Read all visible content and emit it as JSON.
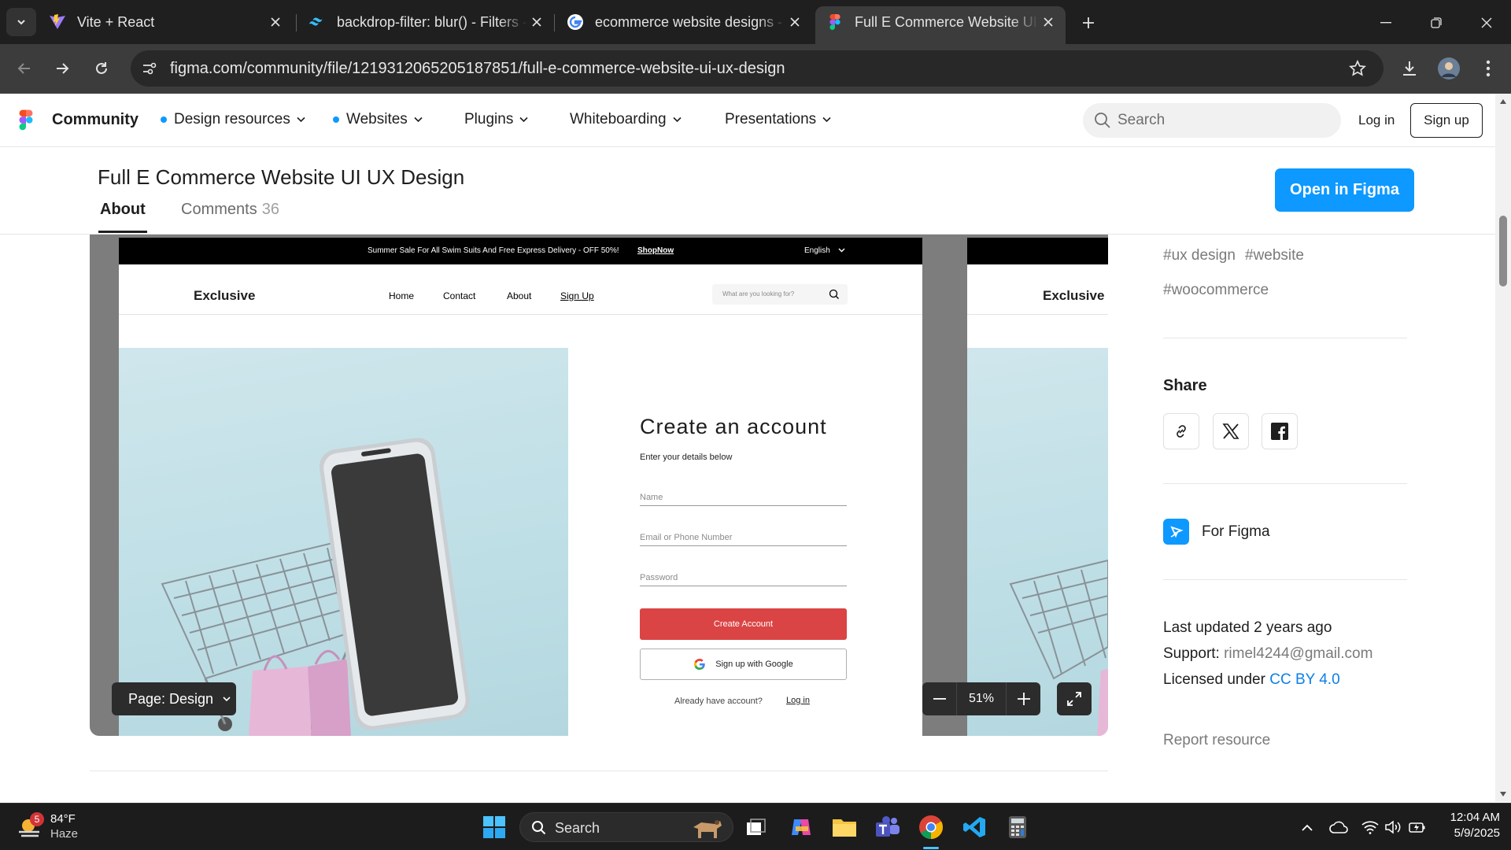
{
  "browser": {
    "tabs": [
      {
        "title": "Vite + React",
        "favicon": "vite-icon"
      },
      {
        "title": "backdrop-filter: blur() - Filters -",
        "favicon": "tailwind-icon"
      },
      {
        "title": "ecommerce website designs - G",
        "favicon": "google-icon"
      },
      {
        "title": "Full E Commerce Website UI UX",
        "favicon": "figma-icon",
        "active": true
      }
    ],
    "url": "figma.com/community/file/1219312065205187851/full-e-commerce-website-ui-ux-design"
  },
  "header": {
    "brand": "Community",
    "nav": [
      {
        "label": "Design resources",
        "dot": true
      },
      {
        "label": "Websites",
        "dot": true
      },
      {
        "label": "Plugins",
        "dot": false
      },
      {
        "label": "Whiteboarding",
        "dot": false
      },
      {
        "label": "Presentations",
        "dot": false
      }
    ],
    "search_placeholder": "Search",
    "login": "Log in",
    "signup": "Sign up"
  },
  "file": {
    "title": "Full E Commerce Website UI UX Design",
    "tab_about": "About",
    "tab_comments": "Comments",
    "comments_count": "36",
    "open_button": "Open in Figma"
  },
  "preview": {
    "promo_text": "Summer Sale For All Swim Suits And Free Express Delivery - OFF 50%!",
    "promo_link": "ShopNow",
    "language": "English",
    "logo": "Exclusive",
    "nav": [
      "Home",
      "Contact",
      "About",
      "Sign Up"
    ],
    "search_placeholder": "What are you looking for?",
    "form_title": "Create an account",
    "form_subtitle": "Enter your details below",
    "fields": [
      "Name",
      "Email or Phone Number",
      "Password"
    ],
    "create_button": "Create Account",
    "google_button": "Sign up with Google",
    "have_account": "Already have account?",
    "login_link": "Log in",
    "page_selector": "Page: Design",
    "zoom": "51%"
  },
  "sidebar": {
    "tags": [
      "#ux design",
      "#website",
      "#woocommerce"
    ],
    "share_title": "Share",
    "for_figma": "For Figma",
    "last_updated_label": "Last updated",
    "last_updated_value": "2 years ago",
    "support_label": "Support:",
    "support_email": "rimel4244@gmail.com",
    "license_label": "Licensed under",
    "license_value": "CC BY 4.0",
    "report": "Report resource"
  },
  "taskbar": {
    "weather_temp": "84°F",
    "weather_desc": "Haze",
    "weather_badge": "5",
    "search": "Search",
    "time": "12:04 AM",
    "date": "5/9/2025"
  },
  "colors": {
    "figma_blue": "#0d99ff",
    "create_red": "#db4444",
    "chrome_dark": "#1f1f1f"
  }
}
